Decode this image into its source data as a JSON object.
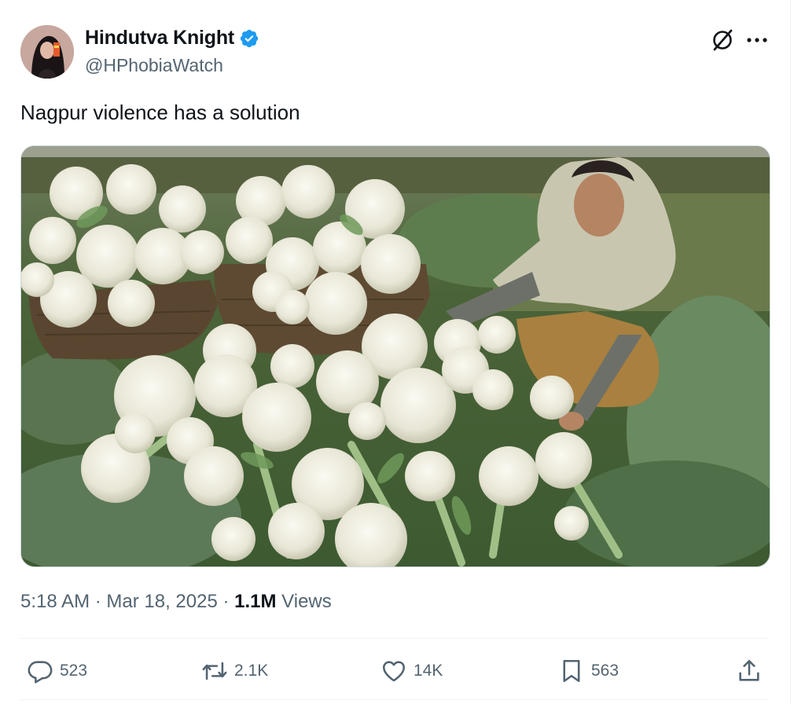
{
  "author": {
    "display_name": "Hindutva Knight",
    "handle": "@HPhobiaWatch",
    "verified_badge_color": "#1d9bf0"
  },
  "tweet": {
    "text": "Nagpur violence has a solution",
    "media_description_icon": "photo-cauliflower-field"
  },
  "meta": {
    "time": "5:18 AM",
    "separator": " · ",
    "date": "Mar 18, 2025",
    "views_count": "1.1M",
    "views_label": " Views"
  },
  "actions": {
    "replies": "523",
    "reposts": "2.1K",
    "likes": "14K",
    "bookmarks": "563"
  },
  "icons": {
    "grok": "grok-icon",
    "more": "more-icon",
    "reply": "reply-icon",
    "repost": "repost-icon",
    "like": "like-icon",
    "bookmark": "bookmark-icon",
    "share": "share-icon"
  },
  "colors": {
    "text_primary": "#0f1419",
    "text_secondary": "#536471",
    "divider": "#eff3f4"
  }
}
